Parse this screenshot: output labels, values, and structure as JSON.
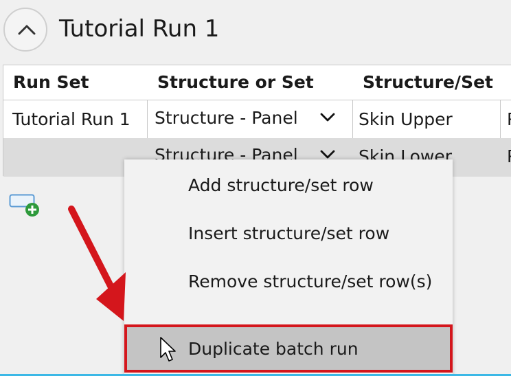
{
  "header": {
    "title": "Tutorial Run 1"
  },
  "table": {
    "columns": [
      "Run Set",
      "Structure or Set",
      "Structure/Set"
    ],
    "rows": [
      {
        "run_set": "Tutorial Run 1",
        "structure_or_set": "Structure - Panel",
        "structure": "Skin Upper",
        "next": "P"
      },
      {
        "run_set": "",
        "structure_or_set": "Structure - Panel",
        "structure": "Skin Lower",
        "next": "P"
      }
    ]
  },
  "context_menu": {
    "items": [
      "Add structure/set row",
      "Insert structure/set row",
      "Remove structure/set row(s)",
      "Duplicate batch run"
    ]
  },
  "colors": {
    "highlight_border": "#d4161c",
    "arrow": "#d4161c",
    "accent": "#3cb8e6"
  }
}
